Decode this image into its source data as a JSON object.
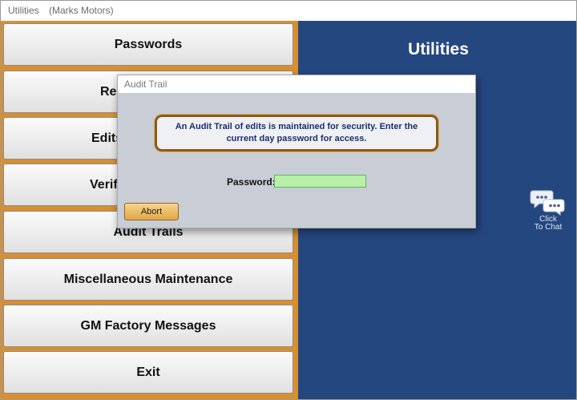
{
  "window": {
    "title": "Utilities",
    "subtitle": "(Marks Motors)"
  },
  "menu": {
    "items": [
      {
        "label": "Passwords"
      },
      {
        "label": "Res"
      },
      {
        "label": "Edits"
      },
      {
        "label": "Verif"
      },
      {
        "label": "Audit Trails"
      },
      {
        "label": "Miscellaneous Maintenance"
      },
      {
        "label": "GM Factory Messages"
      },
      {
        "label": "Exit"
      }
    ]
  },
  "panel": {
    "title": "Utilities",
    "background": "#254780"
  },
  "chat": {
    "icon": "chat-bubbles-icon",
    "line1": "Click",
    "line2": "To Chat"
  },
  "dialog": {
    "title": "Audit Trail",
    "message_line1": "An Audit Trail of edits is maintained for security.  Enter the",
    "message_line2": "current day password for access.",
    "password_label": "Password:",
    "password_value": "",
    "abort_label": "Abort"
  },
  "colors": {
    "menu_background": "#d98f2e",
    "password_field": "#b8f0a8",
    "abort_button": "#e8b860"
  }
}
